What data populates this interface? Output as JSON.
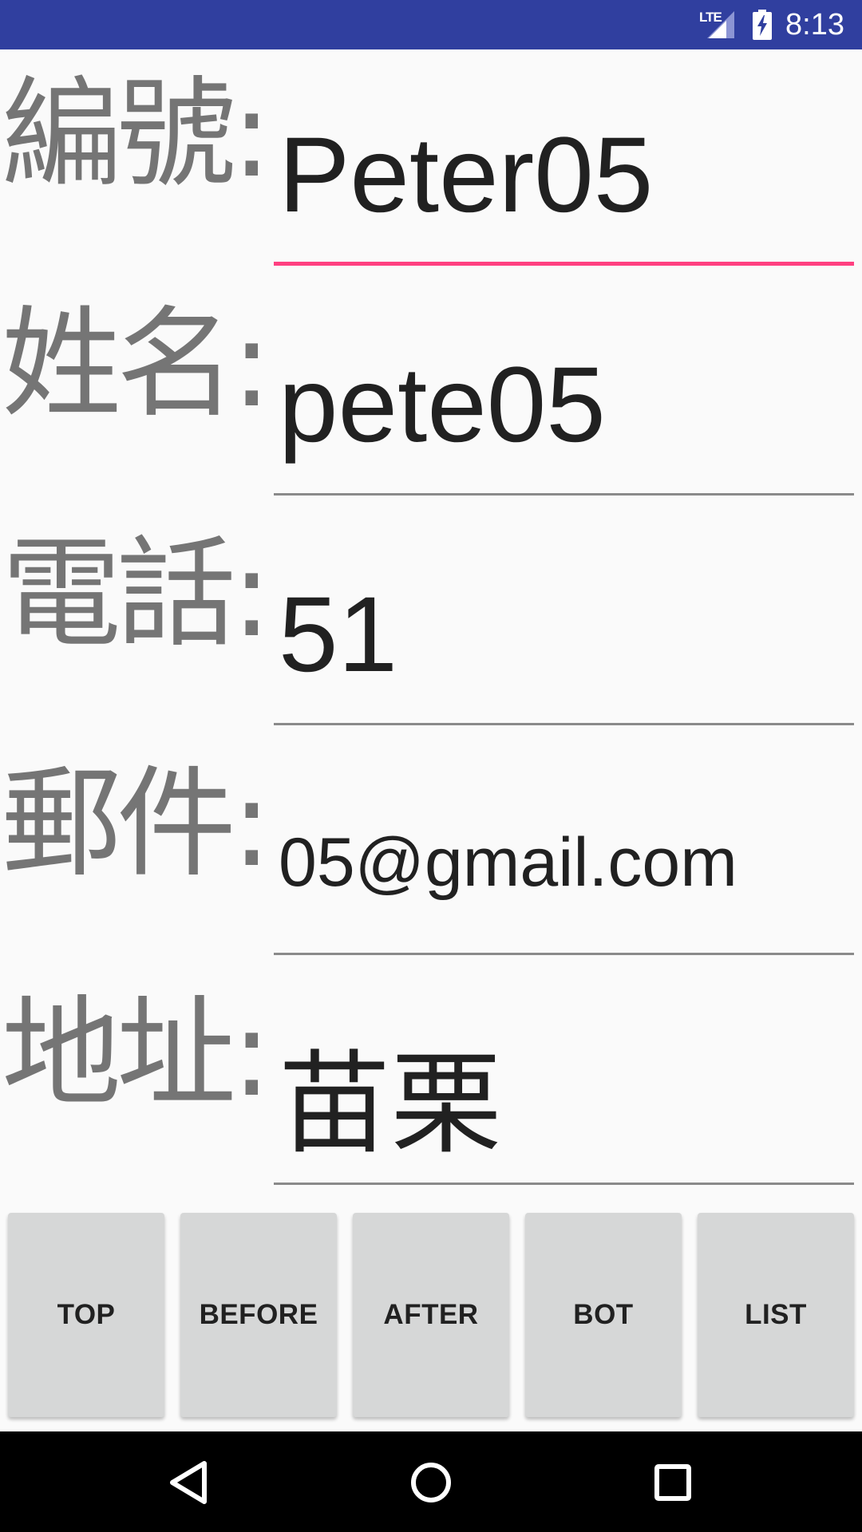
{
  "status_bar": {
    "network_label": "LTE",
    "time": "8:13",
    "background_color": "#303f9f"
  },
  "form": {
    "fields": [
      {
        "label": "編號:",
        "value": "Peter05",
        "focused": true
      },
      {
        "label": "姓名:",
        "value": "pete05",
        "focused": false
      },
      {
        "label": "電話:",
        "value": "51",
        "focused": false
      },
      {
        "label": "郵件:",
        "value": "05@gmail.com",
        "focused": false
      },
      {
        "label": "地址:",
        "value": "苗栗",
        "focused": false
      }
    ],
    "focus_underline_color": "#ff4081"
  },
  "buttons": {
    "top": "TOP",
    "before": "BEFORE",
    "after": "AFTER",
    "bot": "BOT",
    "list": "LIST"
  },
  "nav_bar": {
    "back_icon": "back-triangle-icon",
    "home_icon": "home-circle-icon",
    "recents_icon": "recents-square-icon"
  }
}
